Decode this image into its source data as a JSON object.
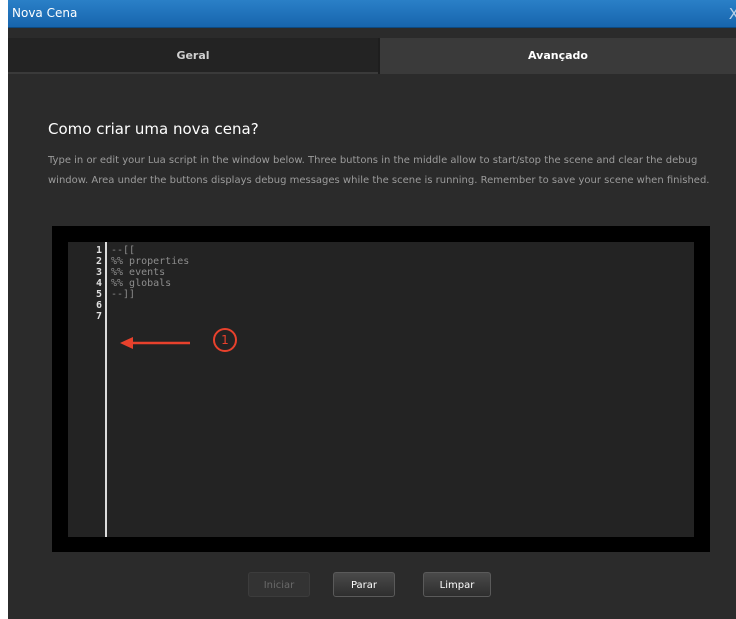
{
  "window": {
    "title": "Nova Cena",
    "close_glyph": "X"
  },
  "tabs": [
    {
      "label": "Geral",
      "active": false
    },
    {
      "label": "Avançado",
      "active": true
    }
  ],
  "main": {
    "heading": "Como criar uma nova cena?",
    "description": "Type in or edit your Lua script in the window below. Three buttons in the middle allow to start/stop the scene and clear the debug window. Area under the buttons displays debug messages while the scene is running. Remember to save your scene when finished."
  },
  "editor": {
    "line_numbers": [
      "1",
      "2",
      "3",
      "4",
      "5",
      "6",
      "7"
    ],
    "lines": [
      "--[[",
      "%% properties",
      "%% events",
      "%% globals",
      "--]]",
      "",
      ""
    ]
  },
  "annotation": {
    "number": "1",
    "color": "#e8412c"
  },
  "buttons": {
    "start_label": "Iniciar",
    "stop_label": "Parar",
    "clear_label": "Limpar"
  },
  "colors": {
    "title_bar": "#1f6fba",
    "background": "#2b2b2b",
    "accent": "#e8412c"
  }
}
